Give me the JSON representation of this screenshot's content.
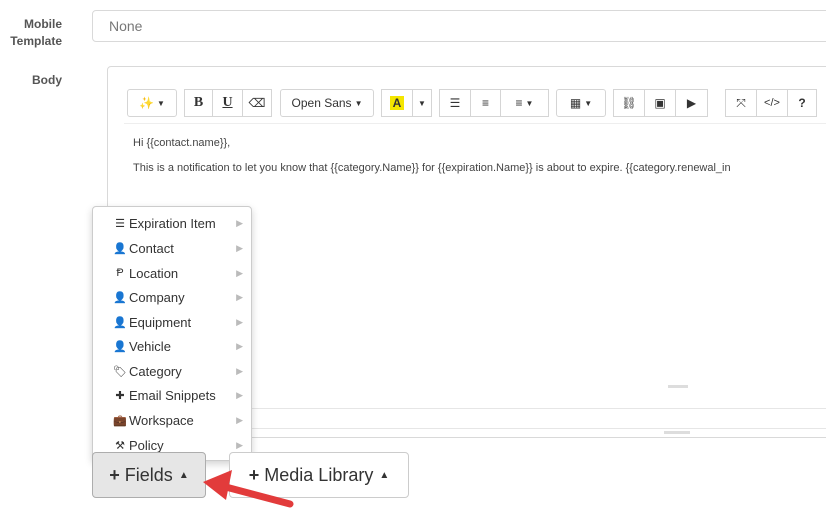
{
  "labels": {
    "mobile_template": "Mobile Template",
    "body": "Body"
  },
  "mobile_template_select": {
    "value": "None"
  },
  "toolbar": {
    "magic": "✨",
    "bold": "B",
    "underline": "U",
    "eraser": "⌫",
    "font": "Open Sans",
    "highlight": "A",
    "ul": "☰",
    "ol": "≡",
    "align": "≡",
    "table": "▦",
    "link": "⛓",
    "picture": "▣",
    "video": "▶",
    "fullscreen": "⤧",
    "code": "</>",
    "help": "?"
  },
  "body_content": {
    "line1": "Hi {{contact.name}},",
    "line2": "This is a notification to let you know that {{category.Name}} for {{expiration.Name}} is about to expire. {{category.renewal_in"
  },
  "fields_menu": [
    {
      "label": "Expiration Item",
      "icon": "list-icon",
      "glyph": "☰"
    },
    {
      "label": "Contact",
      "icon": "user-icon",
      "glyph": "👤"
    },
    {
      "label": "Location",
      "icon": "location-icon",
      "glyph": "Ᵽ"
    },
    {
      "label": "Company",
      "icon": "user-icon",
      "glyph": "👤"
    },
    {
      "label": "Equipment",
      "icon": "user-icon",
      "glyph": "👤"
    },
    {
      "label": "Vehicle",
      "icon": "user-icon",
      "glyph": "👤"
    },
    {
      "label": "Category",
      "icon": "tags-icon",
      "glyph": "🏷"
    },
    {
      "label": "Email Snippets",
      "icon": "puzzle-icon",
      "glyph": "✚"
    },
    {
      "label": "Workspace",
      "icon": "briefcase-icon",
      "glyph": "💼"
    },
    {
      "label": "Policy",
      "icon": "gavel-icon",
      "glyph": "⚒"
    }
  ],
  "buttons": {
    "fields": "Fields",
    "media_library": "Media Library"
  },
  "colors": {
    "arrow": "#e23b3b",
    "highlight": "#f4e600"
  }
}
